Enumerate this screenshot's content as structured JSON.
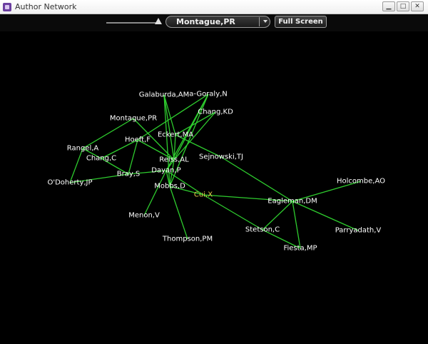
{
  "window": {
    "title": "Author Network",
    "app_icon": "graph-app-icon"
  },
  "controls": {
    "zoom_slider": {
      "icon": "slider-thumb-icon"
    },
    "author_select": {
      "value": "Montague,PR",
      "icon": "chevron-down-icon"
    },
    "fullscreen_label": "Full Screen"
  },
  "colors": {
    "edge": "#2ecc2e",
    "node_text": "#ffffff",
    "highlight": "#e8c84a",
    "background": "#000000"
  },
  "network": {
    "nodes": [
      {
        "id": "galaburda",
        "label": "Galaburda,AM"
      },
      {
        "id": "agoraly",
        "label": "a-Goraly,N"
      },
      {
        "id": "changkd",
        "label": "Chang,KD"
      },
      {
        "id": "montague",
        "label": "Montague,PR"
      },
      {
        "id": "eckert",
        "label": "Eckert,MA"
      },
      {
        "id": "hoeft",
        "label": "Hoeft,F"
      },
      {
        "id": "rangel",
        "label": "Rangel,A"
      },
      {
        "id": "changc",
        "label": "Chang,C"
      },
      {
        "id": "sejnowski",
        "label": "Sejnowski,TJ"
      },
      {
        "id": "reiss",
        "label": "Reiss,AL"
      },
      {
        "id": "dayan",
        "label": "Dayan,P"
      },
      {
        "id": "bray",
        "label": "Bray,S"
      },
      {
        "id": "odoherty",
        "label": "O'Doherty,JP"
      },
      {
        "id": "mobbs",
        "label": "Mobbs,D"
      },
      {
        "id": "cui",
        "label": "Cui,X",
        "highlighted": true
      },
      {
        "id": "holcombe",
        "label": "Holcombe,AO"
      },
      {
        "id": "eagleman",
        "label": "Eagleman,DM"
      },
      {
        "id": "menon",
        "label": "Menon,V"
      },
      {
        "id": "stetson",
        "label": "Stetson,C"
      },
      {
        "id": "parryadath",
        "label": "Parryadath,V"
      },
      {
        "id": "thompson",
        "label": "Thompson,PM"
      },
      {
        "id": "fiesta",
        "label": "Fiesta,MP"
      }
    ],
    "edges": [
      [
        "montague",
        "rangel"
      ],
      [
        "montague",
        "reiss"
      ],
      [
        "rangel",
        "odoherty"
      ],
      [
        "rangel",
        "changc"
      ],
      [
        "galaburda",
        "eckert"
      ],
      [
        "galaburda",
        "reiss"
      ],
      [
        "galaburda",
        "mobbs"
      ],
      [
        "agoraly",
        "hoeft"
      ],
      [
        "agoraly",
        "reiss"
      ],
      [
        "agoraly",
        "mobbs"
      ],
      [
        "agoraly",
        "dayan"
      ],
      [
        "changkd",
        "eckert"
      ],
      [
        "changkd",
        "reiss"
      ],
      [
        "hoeft",
        "changc"
      ],
      [
        "hoeft",
        "bray"
      ],
      [
        "hoeft",
        "reiss"
      ],
      [
        "eckert",
        "reiss"
      ],
      [
        "eckert",
        "sejnowski"
      ],
      [
        "changc",
        "bray"
      ],
      [
        "bray",
        "odoherty"
      ],
      [
        "bray",
        "dayan"
      ],
      [
        "sejnowski",
        "eagleman"
      ],
      [
        "reiss",
        "mobbs"
      ],
      [
        "reiss",
        "dayan"
      ],
      [
        "dayan",
        "mobbs"
      ],
      [
        "dayan",
        "menon"
      ],
      [
        "dayan",
        "cui"
      ],
      [
        "mobbs",
        "cui"
      ],
      [
        "mobbs",
        "thompson"
      ],
      [
        "cui",
        "eagleman"
      ],
      [
        "cui",
        "stetson"
      ],
      [
        "eagleman",
        "holcombe"
      ],
      [
        "eagleman",
        "parryadath"
      ],
      [
        "eagleman",
        "stetson"
      ],
      [
        "eagleman",
        "fiesta"
      ],
      [
        "stetson",
        "fiesta"
      ]
    ]
  }
}
